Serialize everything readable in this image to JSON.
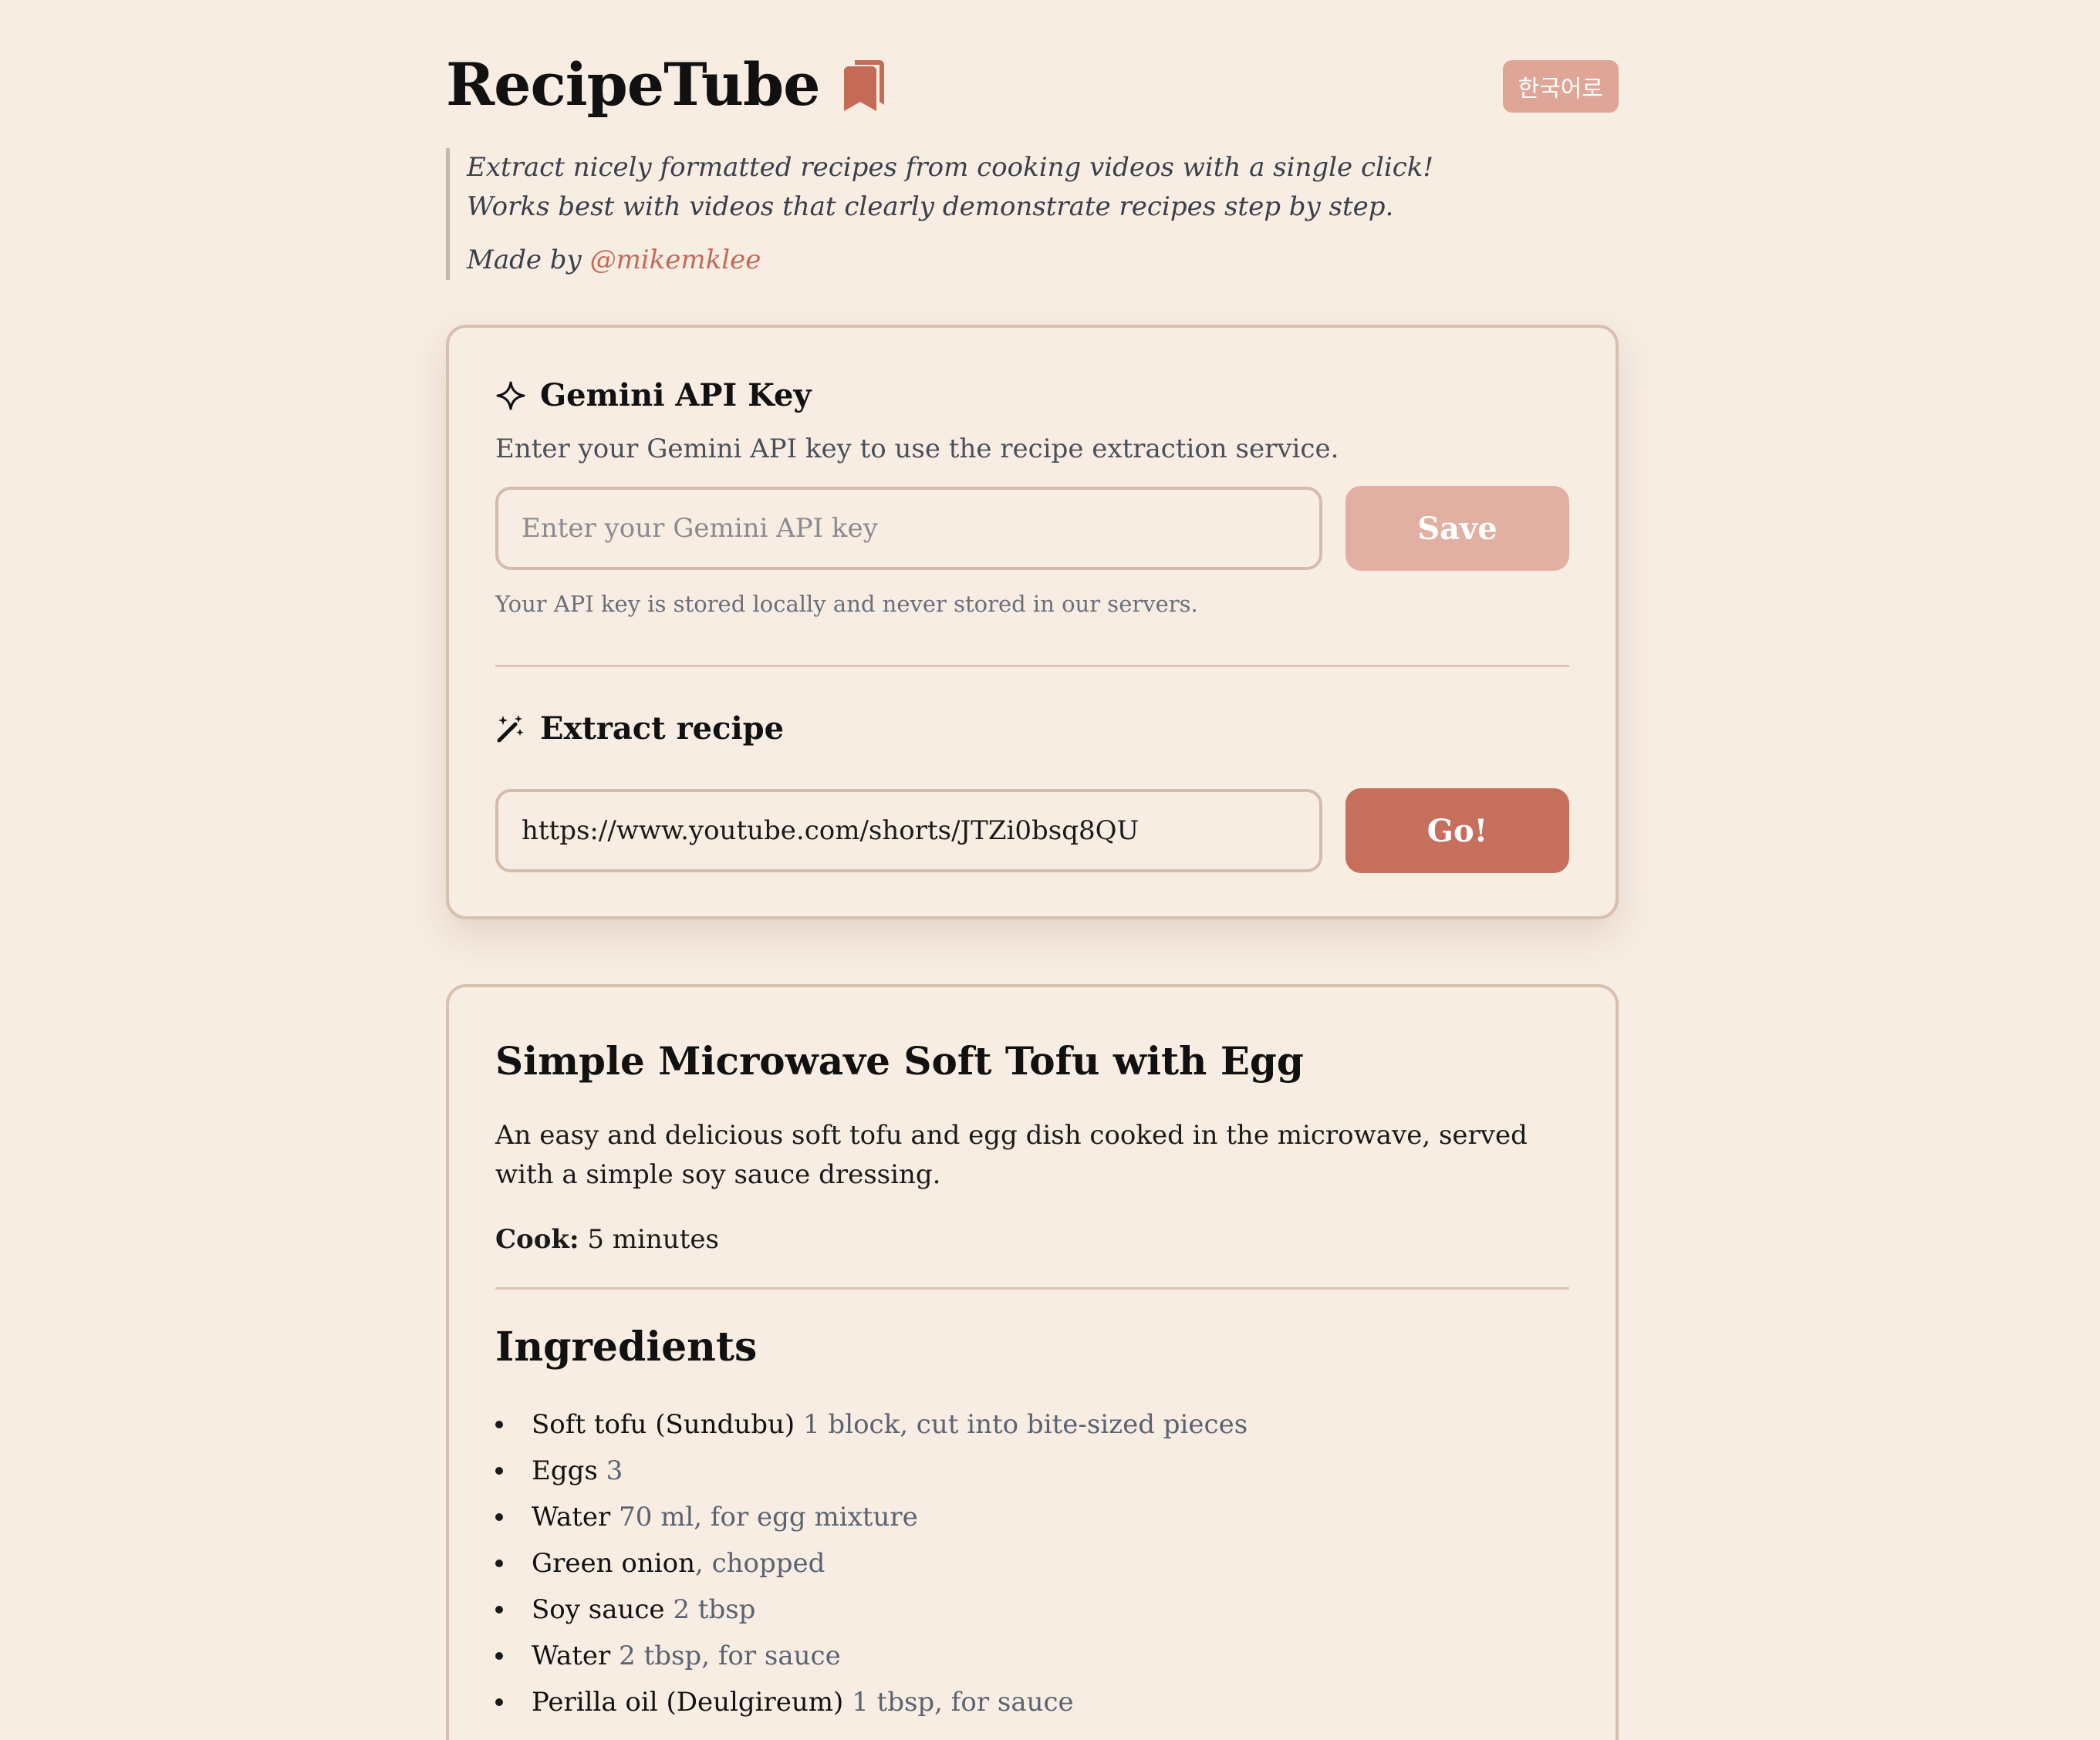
{
  "header": {
    "title": "RecipeTube",
    "logo_icon": "bookmarks-icon",
    "lang_button": "한국어로"
  },
  "tagline": {
    "line1": "Extract nicely formatted recipes from cooking videos with a single click!",
    "line2": "Works best with videos that clearly demonstrate recipes step by step.",
    "made_by": "Made by",
    "handle": "@mikemklee"
  },
  "api_key": {
    "title": "Gemini API Key",
    "icon": "sparkle-icon",
    "description": "Enter your Gemini API key to use the recipe extraction service.",
    "placeholder": "Enter your Gemini API key",
    "value": "",
    "save_label": "Save",
    "note": "Your API key is stored locally and never stored in our servers."
  },
  "extract": {
    "title": "Extract recipe",
    "icon": "magic-wand-icon",
    "url_value": "https://www.youtube.com/shorts/JTZi0bsq8QU",
    "go_label": "Go!"
  },
  "recipe": {
    "title": "Simple Microwave Soft Tofu with Egg",
    "description": "An easy and delicious soft tofu and egg dish cooked in the microwave, served with a simple soy sauce dressing.",
    "cook_label": "Cook:",
    "cook_time": "5 minutes",
    "ingredients_title": "Ingredients",
    "ingredients": [
      {
        "name": "Soft tofu (Sundubu)",
        "detail": " 1 block, cut into bite-sized pieces"
      },
      {
        "name": "Eggs",
        "detail": " 3"
      },
      {
        "name": "Water",
        "detail": " 70 ml, for egg mixture"
      },
      {
        "name": "Green onion",
        "detail": ", chopped"
      },
      {
        "name": "Soy sauce",
        "detail": " 2 tbsp"
      },
      {
        "name": "Water",
        "detail": " 2 tbsp, for sauce"
      },
      {
        "name": "Perilla oil (Deulgireum)",
        "detail": " 1 tbsp, for sauce"
      }
    ]
  }
}
